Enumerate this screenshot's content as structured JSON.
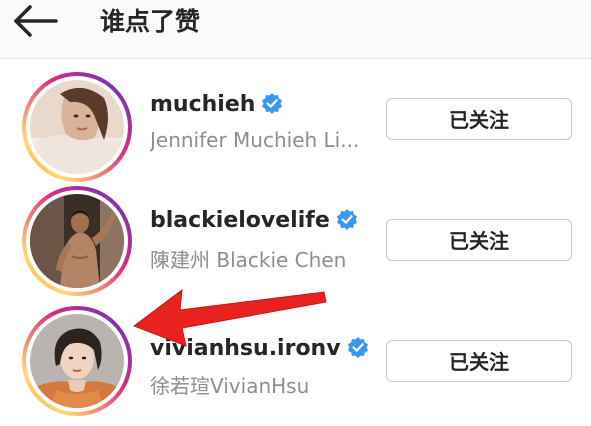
{
  "header": {
    "title": "谁点了赞",
    "back_icon": "arrow-left-icon"
  },
  "users": [
    {
      "username": "muchieh",
      "full_name": "Jennifer Muchieh Li...",
      "verified": true,
      "follow_label": "已关注"
    },
    {
      "username": "blackielovelife",
      "full_name": "陳建州 Blackie Chen",
      "verified": true,
      "follow_label": "已关注"
    },
    {
      "username": "vivianhsu.ironv",
      "full_name": "徐若瑄VivianHsu",
      "verified": true,
      "follow_label": "已关注"
    }
  ],
  "colors": {
    "verified_badge": "#3897f0",
    "annotation_arrow": "#e8231f",
    "secondary_text": "#8e8e8e"
  }
}
